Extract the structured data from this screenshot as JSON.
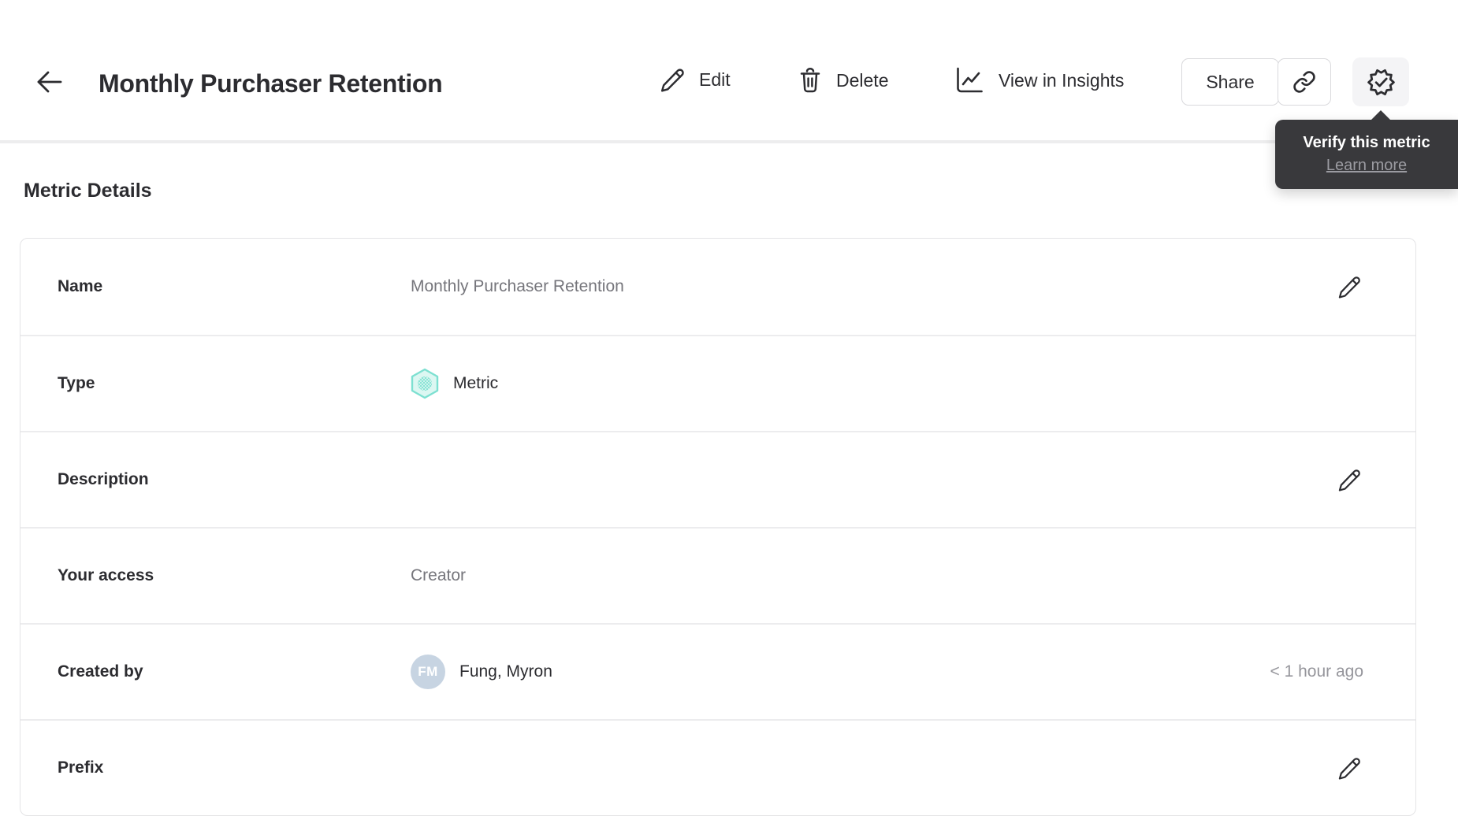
{
  "header": {
    "back_icon": "arrow-left",
    "title": "Monthly Purchaser Retention",
    "edit_label": "Edit",
    "edit_icon": "pencil",
    "delete_label": "Delete",
    "delete_icon": "trash",
    "insights_label": "View in Insights",
    "insights_icon": "line-chart",
    "share_label": "Share",
    "copy_link_icon": "link",
    "verify_icon": "verified-badge"
  },
  "tooltip": {
    "title": "Verify this metric",
    "link_label": "Learn more"
  },
  "metric_details": {
    "heading": "Metric Details",
    "rows": [
      {
        "label": "Name",
        "value": "Monthly Purchaser Retention",
        "action_icon": "pencil"
      },
      {
        "label": "Type",
        "value": "Metric",
        "icon": "metric-hexagon"
      },
      {
        "label": "Description",
        "value": "",
        "action_icon": "pencil"
      },
      {
        "label": "Your access",
        "value": "Creator"
      },
      {
        "label": "Created by",
        "value": "Fung, Myron",
        "avatar_initials": "FM",
        "timestamp": "< 1 hour ago"
      },
      {
        "label": "Prefix",
        "value": "",
        "action_icon": "pencil"
      }
    ]
  },
  "colors": {
    "text_primary": "#2c2c30",
    "text_secondary": "#76767c",
    "text_muted": "#96969c",
    "card_border": "#e4e4e6",
    "divider": "#ececee",
    "tooltip_bg": "#39393c",
    "tooltip_link": "#9b9ba1",
    "avatar_bg": "#c7d4e2",
    "metric_icon_teal": "#7de0d1",
    "metric_icon_fill": "#dcf7f2",
    "verify_button_bg": "#f4f4f6"
  }
}
